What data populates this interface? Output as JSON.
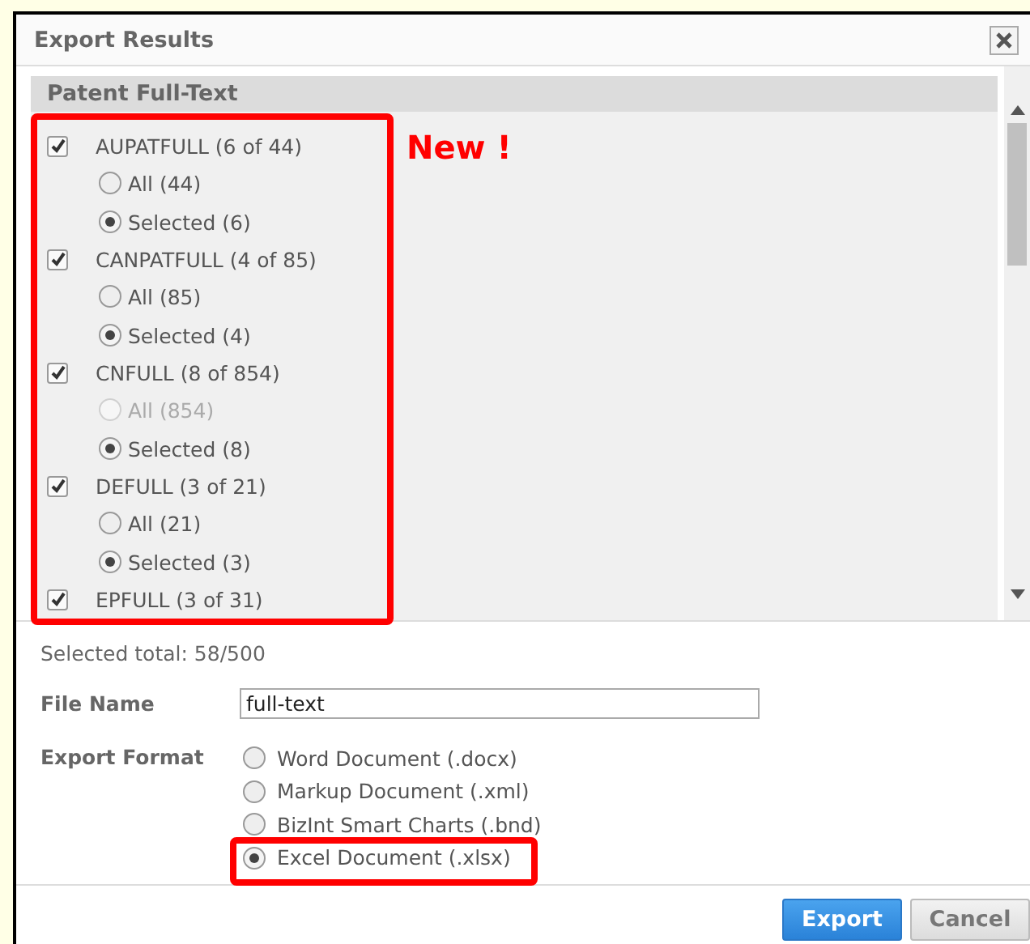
{
  "dialog": {
    "title": "Export Results"
  },
  "section": {
    "title": "Patent Full-Text",
    "databases": [
      {
        "label": "AUPATFULL (6 of 44)",
        "checked": true,
        "options": [
          {
            "label": "All (44)",
            "selected": false,
            "disabled": false
          },
          {
            "label": "Selected (6)",
            "selected": true,
            "disabled": false
          }
        ]
      },
      {
        "label": "CANPATFULL (4 of 85)",
        "checked": true,
        "options": [
          {
            "label": "All (85)",
            "selected": false,
            "disabled": false
          },
          {
            "label": "Selected (4)",
            "selected": true,
            "disabled": false
          }
        ]
      },
      {
        "label": "CNFULL (8 of 854)",
        "checked": true,
        "options": [
          {
            "label": "All (854)",
            "selected": false,
            "disabled": true
          },
          {
            "label": "Selected (8)",
            "selected": true,
            "disabled": false
          }
        ]
      },
      {
        "label": "DEFULL (3 of 21)",
        "checked": true,
        "options": [
          {
            "label": "All (21)",
            "selected": false,
            "disabled": false
          },
          {
            "label": "Selected (3)",
            "selected": true,
            "disabled": false
          }
        ]
      },
      {
        "label": "EPFULL (3 of 31)",
        "checked": true
      }
    ]
  },
  "annotation": {
    "text": "New !"
  },
  "selected_total": "Selected total: 58/500",
  "file_name": {
    "label": "File Name",
    "value": "full-text"
  },
  "export_format": {
    "label": "Export Format",
    "options": [
      {
        "label": "Word Document (.docx)",
        "selected": false
      },
      {
        "label": "Markup Document (.xml)",
        "selected": false
      },
      {
        "label": "BizInt Smart Charts (.bnd)",
        "selected": false
      },
      {
        "label": "Excel Document (.xlsx)",
        "selected": true
      }
    ]
  },
  "buttons": [
    {
      "label": "Export",
      "kind": "primary"
    },
    {
      "label": "Cancel",
      "kind": "secondary"
    }
  ]
}
